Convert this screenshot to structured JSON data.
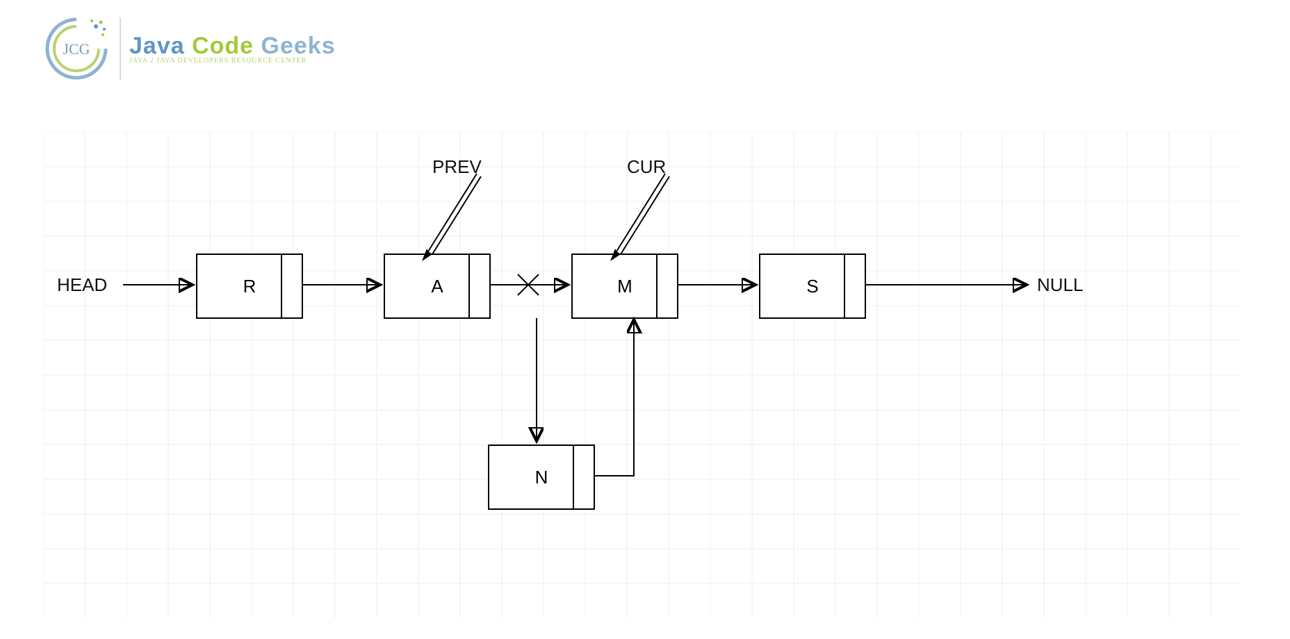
{
  "logo": {
    "word1": "Java",
    "word2": "Code",
    "word3": "Geeks",
    "subtitle": "JAVA 2 JAVA DEVELOPERS RESOURCE CENTER",
    "monogram": "JCG"
  },
  "diagram": {
    "head_label": "HEAD",
    "null_label": "NULL",
    "prev_label": "PREV",
    "cur_label": "CUR",
    "nodes": {
      "r": "R",
      "a": "A",
      "m": "M",
      "s": "S",
      "n": "N"
    },
    "semantics": {
      "description": "Singly linked list insertion diagram. HEAD points to R. R.next points to A. A.next previously pointed to M (link shown crossed out). A.next now points to new node N, and N.next points to M. M.next points to S. S.next points to NULL. PREV pointer references node A. CUR pointer references node M.",
      "list_before": [
        "R",
        "A",
        "M",
        "S"
      ],
      "list_after": [
        "R",
        "A",
        "N",
        "M",
        "S"
      ],
      "inserted_node": "N",
      "prev_points_to": "A",
      "cur_points_to": "M",
      "removed_link": {
        "from": "A",
        "to": "M"
      },
      "added_links": [
        {
          "from": "A",
          "to": "N"
        },
        {
          "from": "N",
          "to": "M"
        }
      ]
    }
  }
}
